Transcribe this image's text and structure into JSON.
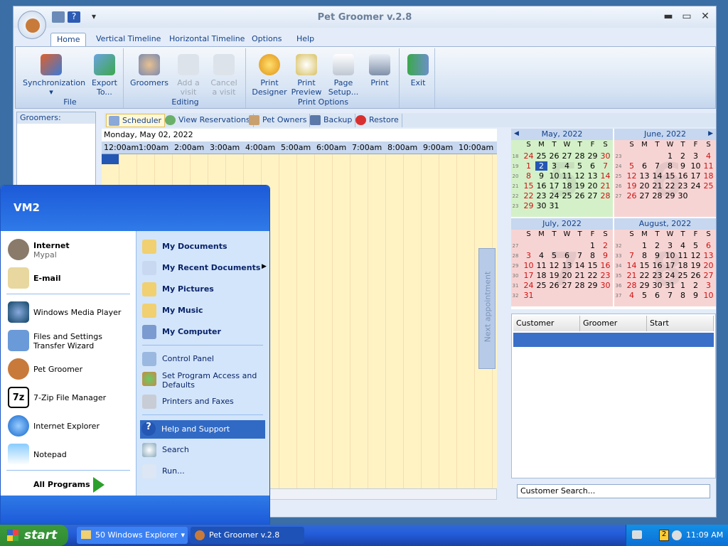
{
  "window": {
    "title": "Pet Groomer v.2.8",
    "min": "▬",
    "max": "▭",
    "close": "✕"
  },
  "tabs": [
    "Home",
    "Vertical Timeline",
    "Horizontal Timeline",
    "Options",
    "Help"
  ],
  "ribbon": {
    "file": {
      "label": "File",
      "sync": "Synchronization",
      "export1": "Export",
      "export2": "To..."
    },
    "editing": {
      "label": "Editing",
      "groomers": "Groomers",
      "add1": "Add a",
      "add2": "visit",
      "cancel1": "Cancel",
      "cancel2": "a visit"
    },
    "print": {
      "label": "Print Options",
      "designer1": "Print",
      "designer2": "Designer",
      "preview1": "Print",
      "preview2": "Preview",
      "setup1": "Page",
      "setup2": "Setup...",
      "print": "Print"
    },
    "exit": "Exit"
  },
  "groomers_panel": {
    "header": "Groomers:"
  },
  "view_tabs": [
    "Scheduler",
    "View Reservations",
    "Pet Owners",
    "Backup",
    "Restore"
  ],
  "scheduler": {
    "date": "Monday, May 02, 2022",
    "times": [
      "12:00am",
      "1:00am",
      "2:00am",
      "3:00am",
      "4:00am",
      "5:00am",
      "6:00am",
      "7:00am",
      "8:00am",
      "9:00am",
      "10:00am"
    ],
    "next_appointment": "Next appointment"
  },
  "calendar": {
    "dow": [
      "S",
      "M",
      "T",
      "W",
      "T",
      "F",
      "S"
    ],
    "months": [
      {
        "name": "May, 2022",
        "big": "5",
        "weeks": [
          "18",
          "19",
          "20",
          "21",
          "22",
          "23"
        ],
        "rows": [
          [
            "24",
            "25",
            "26",
            "27",
            "28",
            "29",
            "30"
          ],
          [
            "1",
            "2",
            "3",
            "4",
            "5",
            "6",
            "7"
          ],
          [
            "8",
            "9",
            "10",
            "11",
            "12",
            "13",
            "14"
          ],
          [
            "15",
            "16",
            "17",
            "18",
            "19",
            "20",
            "21"
          ],
          [
            "22",
            "23",
            "24",
            "25",
            "26",
            "27",
            "28"
          ],
          [
            "29",
            "30",
            "31",
            "",
            "",
            "",
            ""
          ]
        ]
      },
      {
        "name": "June, 2022",
        "big": "6",
        "weeks": [
          "23",
          "24",
          "25",
          "26",
          "27",
          ""
        ],
        "rows": [
          [
            "",
            "",
            "",
            "1",
            "2",
            "3",
            "4"
          ],
          [
            "5",
            "6",
            "7",
            "8",
            "9",
            "10",
            "11"
          ],
          [
            "12",
            "13",
            "14",
            "15",
            "16",
            "17",
            "18"
          ],
          [
            "19",
            "20",
            "21",
            "22",
            "23",
            "24",
            "25"
          ],
          [
            "26",
            "27",
            "28",
            "29",
            "30",
            "",
            ""
          ],
          [
            "",
            "",
            "",
            "",
            "",
            "",
            ""
          ]
        ]
      },
      {
        "name": "July, 2022",
        "big": "7",
        "weeks": [
          "27",
          "28",
          "29",
          "30",
          "31",
          "32"
        ],
        "rows": [
          [
            "",
            "",
            "",
            "",
            "",
            "1",
            "2"
          ],
          [
            "3",
            "4",
            "5",
            "6",
            "7",
            "8",
            "9"
          ],
          [
            "10",
            "11",
            "12",
            "13",
            "14",
            "15",
            "16"
          ],
          [
            "17",
            "18",
            "19",
            "20",
            "21",
            "22",
            "23"
          ],
          [
            "24",
            "25",
            "26",
            "27",
            "28",
            "29",
            "30"
          ],
          [
            "31",
            "",
            "",
            "",
            "",
            "",
            ""
          ]
        ]
      },
      {
        "name": "August, 2022",
        "big": "8",
        "weeks": [
          "32",
          "33",
          "34",
          "35",
          "36",
          "37"
        ],
        "rows": [
          [
            "",
            "1",
            "2",
            "3",
            "4",
            "5",
            "6"
          ],
          [
            "7",
            "8",
            "9",
            "10",
            "11",
            "12",
            "13"
          ],
          [
            "14",
            "15",
            "16",
            "17",
            "18",
            "19",
            "20"
          ],
          [
            "21",
            "22",
            "23",
            "24",
            "25",
            "26",
            "27"
          ],
          [
            "28",
            "29",
            "30",
            "31",
            "1",
            "2",
            "3"
          ],
          [
            "4",
            "5",
            "6",
            "7",
            "8",
            "9",
            "10"
          ]
        ]
      }
    ],
    "selected": "2",
    "colors": {
      "may": "#d4f0c8",
      "other": "#f7d4d4",
      "selected": "#2456b4",
      "weekend": "#d01010"
    }
  },
  "appt_grid": {
    "cols": [
      "Customer",
      "Groomer",
      "Start"
    ],
    "search_placeholder": "Customer Search..."
  },
  "start_menu": {
    "user": "VM2",
    "pinned": [
      {
        "title": "Internet",
        "sub": "Mypal"
      },
      {
        "title": "E-mail",
        "sub": ""
      }
    ],
    "recent": [
      "Windows Media Player",
      "Files and Settings Transfer Wizard",
      "Pet Groomer",
      "7-Zip File Manager",
      "Internet Explorer",
      "Notepad"
    ],
    "all_programs": "All Programs",
    "right": [
      "My Documents",
      "My Recent Documents",
      "My Pictures",
      "My Music",
      "My Computer"
    ],
    "right2": [
      "Control Panel",
      "Set Program Access and Defaults",
      "Printers and Faxes"
    ],
    "right3": [
      "Help and Support",
      "Search",
      "Run..."
    ]
  },
  "taskbar": {
    "start": "start",
    "items": [
      "50 Windows Explorer",
      "Pet Groomer v.2.8"
    ],
    "clock": "11:09 AM",
    "tray_num": "2"
  }
}
